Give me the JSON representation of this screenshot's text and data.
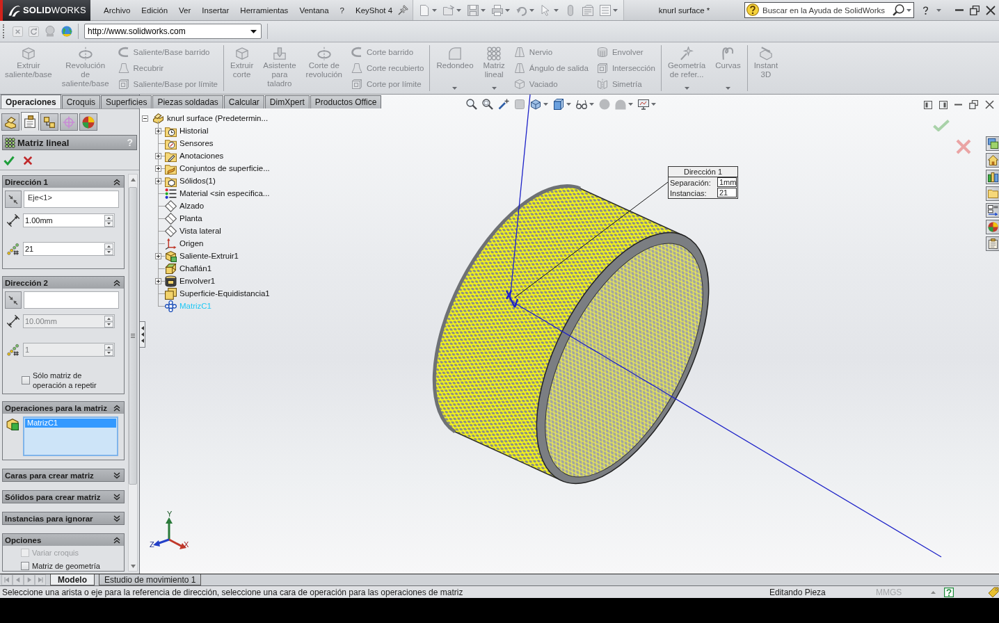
{
  "title_bar": {
    "logo": "**SOLID**WORKS",
    "menu": [
      "Archivo",
      "Edición",
      "Ver",
      "Insertar",
      "Herramientas",
      "Ventana",
      "?",
      "KeyShot 4"
    ],
    "document_title": "knurl surface *",
    "help_search": {
      "placeholder": "Buscar en la Ayuda de SolidWorks"
    }
  },
  "address_bar": {
    "url": "http://www.solidworks.com"
  },
  "ribbon": {
    "groups": [
      {
        "commands": [
          {
            "kind": "large",
            "label": "Extruir saliente/base",
            "disabled": true
          },
          {
            "kind": "large",
            "label": "Revolución de saliente/base",
            "disabled": true
          },
          {
            "kind": "stack",
            "items": [
              {
                "label": "Saliente/Base barrido",
                "disabled": true
              },
              {
                "label": "Recubrir",
                "disabled": true
              },
              {
                "label": "Saliente/Base por límite",
                "disabled": true
              }
            ]
          }
        ]
      },
      {
        "commands": [
          {
            "kind": "large",
            "label": "Extruir corte",
            "disabled": true
          },
          {
            "kind": "large",
            "label": "Asistente para taladro",
            "disabled": true
          },
          {
            "kind": "large",
            "label": "Corte de revolución",
            "disabled": true
          },
          {
            "kind": "stack",
            "items": [
              {
                "label": "Corte barrido",
                "disabled": true
              },
              {
                "label": "Corte recubierto",
                "disabled": true
              },
              {
                "label": "Corte por límite",
                "disabled": true
              }
            ]
          }
        ]
      },
      {
        "commands": [
          {
            "kind": "dropdown",
            "label": "Redondeo",
            "disabled": true
          },
          {
            "kind": "dropdown",
            "label": "Matriz lineal",
            "disabled": true
          },
          {
            "kind": "stack",
            "items": [
              {
                "label": "Nervio",
                "disabled": true
              },
              {
                "label": "Ángulo de salida",
                "disabled": true
              },
              {
                "label": "Vaciado",
                "disabled": true
              }
            ]
          },
          {
            "kind": "stack",
            "items": [
              {
                "label": "Envolver",
                "disabled": true
              },
              {
                "label": "Intersección",
                "disabled": true
              },
              {
                "label": "Simetría",
                "disabled": true
              }
            ]
          }
        ]
      },
      {
        "commands": [
          {
            "kind": "dropdown",
            "label": "Geometría de refer...",
            "disabled": true
          },
          {
            "kind": "dropdown",
            "label": "Curvas",
            "disabled": true
          }
        ]
      },
      {
        "commands": [
          {
            "kind": "large",
            "label": "Instant 3D",
            "disabled": true
          }
        ]
      }
    ]
  },
  "command_tabs": [
    {
      "label": "Operaciones",
      "selected": true
    },
    {
      "label": "Croquis",
      "selected": false
    },
    {
      "label": "Superficies",
      "selected": false
    },
    {
      "label": "Piezas soldadas",
      "selected": false
    },
    {
      "label": "Calcular",
      "selected": false
    },
    {
      "label": "DimXpert",
      "selected": false
    },
    {
      "label": "Productos Office",
      "selected": false
    }
  ],
  "panel_tabs": [
    {
      "kind": "features",
      "selected": false
    },
    {
      "kind": "properties",
      "selected": true
    },
    {
      "kind": "configurations",
      "selected": false
    },
    {
      "kind": "dimxpert",
      "selected": false
    },
    {
      "kind": "display",
      "selected": false
    }
  ],
  "property_manager": {
    "title": "Matriz lineal",
    "help": "?",
    "groups": [
      {
        "kind": "direction",
        "title": "Dirección 1",
        "expanded": true,
        "direction": "Eje<1>",
        "spacing": {
          "value": "1.00mm",
          "disabled": false
        },
        "instances": {
          "value": "21",
          "disabled": false
        }
      },
      {
        "kind": "direction",
        "title": "Dirección 2",
        "expanded": true,
        "spacing": {
          "value": "10.00mm",
          "disabled": true
        },
        "instances": {
          "value": "1",
          "disabled": true
        },
        "checkbox": {
          "label": "Sólo matriz de operación a repetir",
          "checked": false
        }
      },
      {
        "kind": "list",
        "title": "Operaciones para la matriz",
        "expanded": true,
        "items": [
          {
            "label": "MatrizC1",
            "selected": true
          }
        ]
      },
      {
        "title": "Caras para crear matriz",
        "expanded": false
      },
      {
        "title": "Sólidos para crear matriz",
        "expanded": false
      },
      {
        "title": "Instancias para ignorar",
        "expanded": false
      },
      {
        "kind": "options",
        "title": "Opciones",
        "expanded": true,
        "checkboxes": [
          {
            "label": "Variar croquis",
            "checked": false,
            "disabled": true
          },
          {
            "label": "Matriz de geometría",
            "checked": false,
            "disabled": false
          }
        ]
      }
    ]
  },
  "feature_tree": {
    "root": {
      "kind": "part",
      "label": "knurl surface (Predetermin...",
      "expanded": true,
      "selected": false,
      "children": [
        {
          "kind": "history",
          "label": "Historial",
          "expanded": false,
          "selected": false
        },
        {
          "kind": "sensors",
          "label": "Sensores",
          "selected": false
        },
        {
          "kind": "annotations",
          "label": "Anotaciones",
          "expanded": false,
          "selected": false
        },
        {
          "kind": "surface-bodies",
          "label": "Conjuntos de superficie...",
          "expanded": false,
          "selected": false
        },
        {
          "kind": "solid-bodies",
          "label": "Sólidos(1)",
          "expanded": false,
          "selected": false
        },
        {
          "kind": "material",
          "label": "Material <sin especifica...",
          "selected": false
        },
        {
          "kind": "plane",
          "label": "Alzado",
          "selected": false
        },
        {
          "kind": "plane",
          "label": "Planta",
          "selected": false
        },
        {
          "kind": "plane",
          "label": "Vista lateral",
          "selected": false
        },
        {
          "kind": "origin",
          "label": "Origen",
          "selected": false
        },
        {
          "kind": "extrude",
          "label": "Saliente-Extruir1",
          "expanded": false,
          "selected": false
        },
        {
          "kind": "chamfer",
          "label": "Chaflán1",
          "selected": false
        },
        {
          "kind": "wrap",
          "label": "Envolver1",
          "expanded": false,
          "selected": false
        },
        {
          "kind": "offset-surface",
          "label": "Superficie-Equidistancia1",
          "selected": false
        },
        {
          "kind": "pattern",
          "label": "MatrizC1",
          "selected": true
        }
      ]
    }
  },
  "callout": {
    "title": "Dirección 1",
    "rows": [
      {
        "label": "Separación:",
        "value": "1mm"
      },
      {
        "label": "Instancias:",
        "value": "21"
      }
    ]
  },
  "triad": {
    "x": "X",
    "y": "Y",
    "z": "Z"
  },
  "model_tabs": [
    {
      "label": "Modelo",
      "selected": true
    },
    {
      "label": "Estudio de movimiento 1",
      "selected": false
    }
  ],
  "status_bar": {
    "message": "Seleccione una arista o eje para la referencia de dirección, seleccione una cara de operación para las operaciones de matriz",
    "mode": "Editando Pieza",
    "units": "MMGS"
  }
}
